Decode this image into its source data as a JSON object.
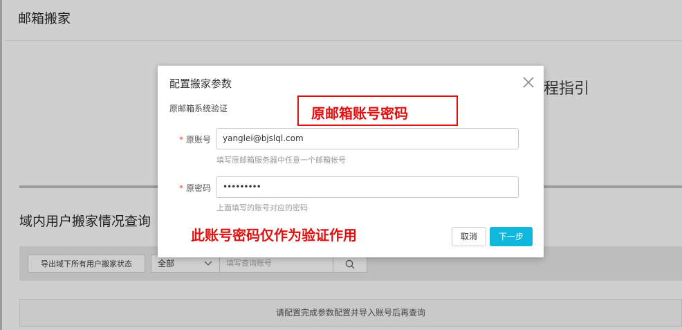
{
  "page": {
    "title": "邮箱搬家",
    "guide_partial": "程指引",
    "section_title": "域内用户搬家情况查询",
    "toolbar": {
      "export_label": "导出域下所有用户搬家状态",
      "filter_value": "全部",
      "query_placeholder": "填写查询账号"
    },
    "result_message": "请配置完成参数配置并导入账号后再查询"
  },
  "modal": {
    "title": "配置搬家参数",
    "subsection": "原邮箱系统验证",
    "account": {
      "label": "原账号",
      "value": "yanglei@bjslql.com",
      "hint": "填写原邮箱服务器中任意一个邮箱帐号"
    },
    "password": {
      "label": "原密码",
      "value": "•••••••••",
      "hint": "上面填写的账号对应的密码"
    },
    "required_mark": "*",
    "cancel_label": "取消",
    "next_label": "下一步"
  },
  "annotations": {
    "box_text": "原邮箱账号密码",
    "note_text": "此账号密码仅作为验证作用",
    "color": "#e01010"
  },
  "colors": {
    "primary": "#0fb7dc",
    "required": "#e24a3b"
  }
}
